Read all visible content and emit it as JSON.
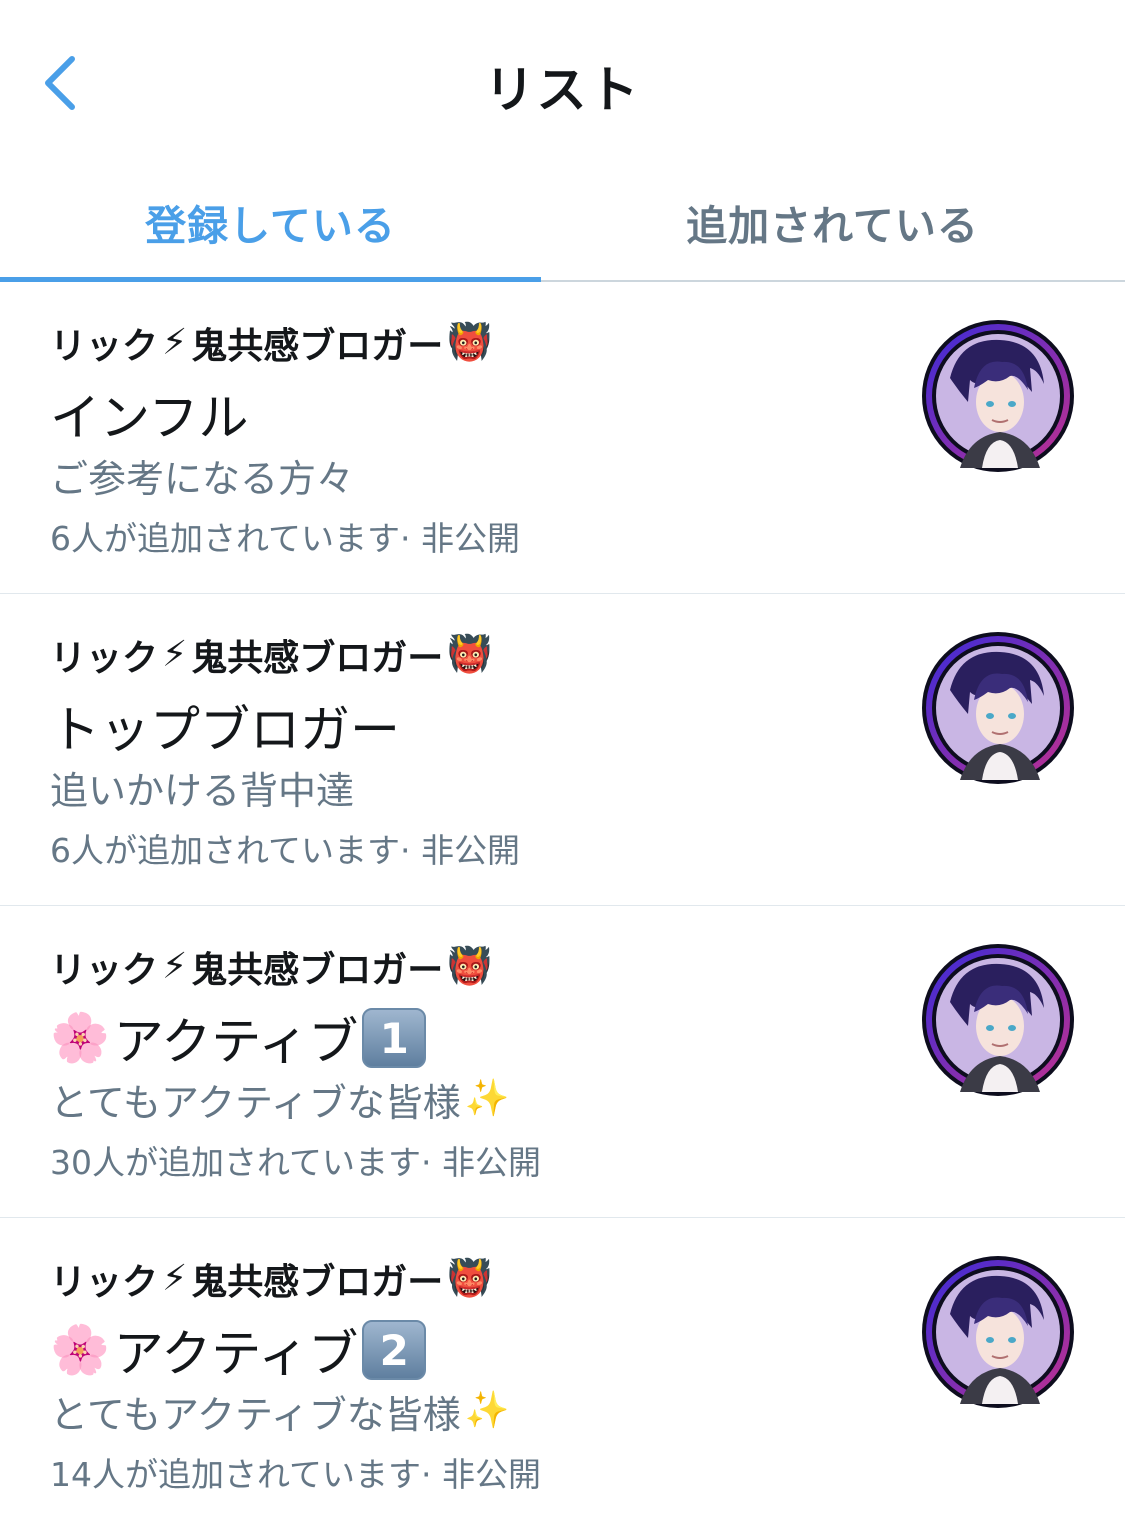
{
  "header": {
    "title": "リスト",
    "back_icon": "chevron-left-icon"
  },
  "tabs": [
    {
      "label": "登録している",
      "active": true
    },
    {
      "label": "追加されている",
      "active": false
    }
  ],
  "colors": {
    "accent": "#4a9fe8",
    "secondary_text": "#657786",
    "primary_text": "#14171a",
    "divider": "#e1e8ed"
  },
  "lists": [
    {
      "owner_name": "リック",
      "owner_icon_1": "⚡",
      "owner_suffix": "鬼共感ブロガー",
      "owner_icon_2": "👹",
      "name_prefix_icon": "",
      "name": "インフル",
      "name_suffix_icon": "",
      "description": "ご参考になる方々",
      "description_suffix_icon": "",
      "meta": "6人が追加されています· 非公開"
    },
    {
      "owner_name": "リック",
      "owner_icon_1": "⚡",
      "owner_suffix": "鬼共感ブロガー",
      "owner_icon_2": "👹",
      "name_prefix_icon": "",
      "name": "トップブロガー",
      "name_suffix_icon": "",
      "description": "追いかける背中達",
      "description_suffix_icon": "",
      "meta": "6人が追加されています· 非公開"
    },
    {
      "owner_name": "リック",
      "owner_icon_1": "⚡",
      "owner_suffix": "鬼共感ブロガー",
      "owner_icon_2": "👹",
      "name_prefix_icon": "🌸",
      "name": "アクティブ",
      "name_suffix_icon": "1",
      "description": "とてもアクティブな皆様",
      "description_suffix_icon": "✨",
      "meta": "30人が追加されています· 非公開"
    },
    {
      "owner_name": "リック",
      "owner_icon_1": "⚡",
      "owner_suffix": "鬼共感ブロガー",
      "owner_icon_2": "👹",
      "name_prefix_icon": "🌸",
      "name": "アクティブ",
      "name_suffix_icon": "2",
      "description": "とてもアクティブな皆様",
      "description_suffix_icon": "✨",
      "meta": "14人が追加されています· 非公開"
    }
  ]
}
